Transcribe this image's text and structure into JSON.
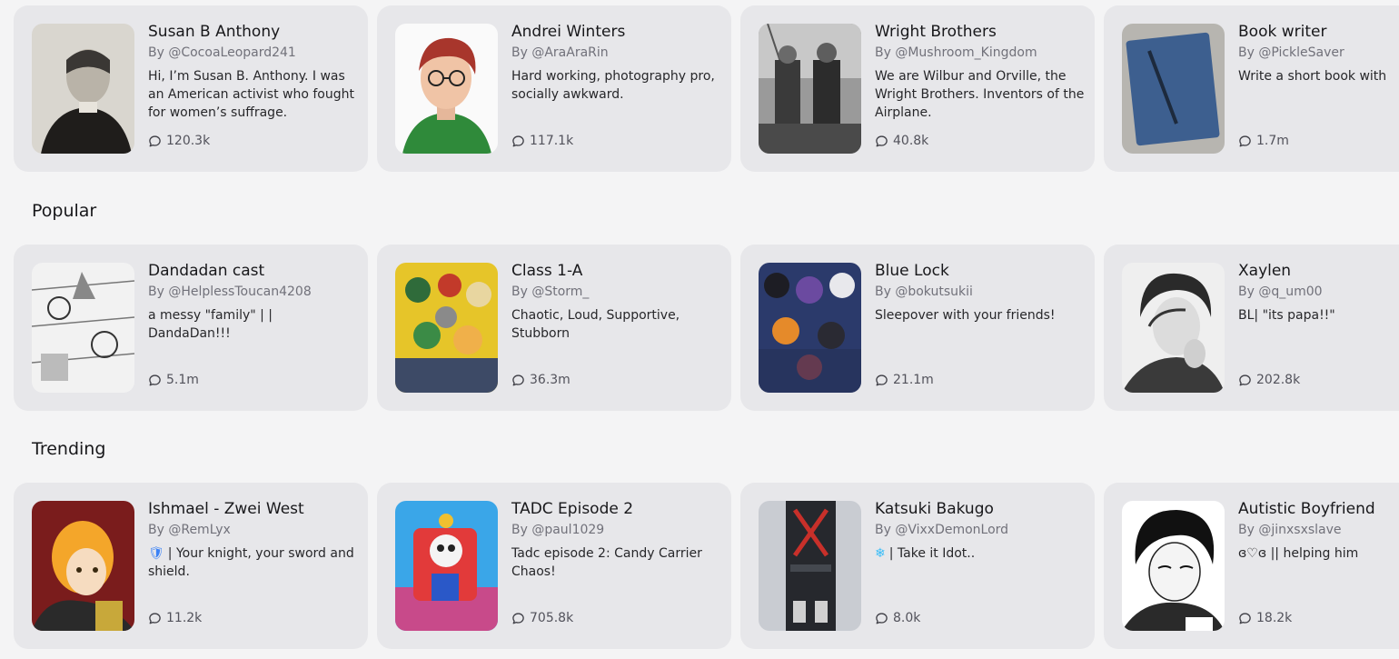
{
  "sections": [
    {
      "title": "",
      "cards": [
        {
          "name": "Susan B Anthony",
          "author": "By @CocoaLeopard241",
          "emoji": "",
          "description": "Hi, I’m Susan B. Anthony. I was an American activist who fought for women’s suffrage.",
          "chats": "120.3k"
        },
        {
          "name": "Andrei Winters",
          "author": "By @AraAraRin",
          "emoji": "",
          "description": "Hard working, photography pro, socially awkward.",
          "chats": "117.1k"
        },
        {
          "name": "Wright Brothers",
          "author": "By @Mushroom_Kingdom",
          "emoji": "",
          "description": "We are Wilbur and Orville, the Wright Brothers. Inventors of the Airplane.",
          "chats": "40.8k"
        },
        {
          "name": "Book writer",
          "author": "By @PickleSaver",
          "emoji": "",
          "description": "Write a short book with",
          "chats": "1.7m"
        }
      ]
    },
    {
      "title": "Popular",
      "cards": [
        {
          "name": "Dandadan cast",
          "author": "By @HelplessToucan4208",
          "emoji": "",
          "description": "a messy \"family\" | | DandaDan!!!",
          "chats": "5.1m"
        },
        {
          "name": "Class 1-A",
          "author": "By @Storm_",
          "emoji": "",
          "description": "Chaotic, Loud, Supportive, Stubborn",
          "chats": "36.3m"
        },
        {
          "name": "Blue Lock",
          "author": "By @bokutsukii",
          "emoji": "",
          "description": "Sleepover with your friends!",
          "chats": "21.1m"
        },
        {
          "name": "Xaylen",
          "author": "By @q_um00",
          "emoji": "",
          "description": "BL| \"its papa!!\"",
          "chats": "202.8k"
        }
      ]
    },
    {
      "title": "Trending",
      "cards": [
        {
          "name": "Ishmael - Zwei West",
          "author": "By @RemLyx",
          "emoji": "🛡",
          "description": "| Your knight, your sword and shield.",
          "chats": "11.2k"
        },
        {
          "name": "TADC Episode 2",
          "author": "By @paul1029",
          "emoji": "",
          "description": "Tadc episode 2: Candy Carrier Chaos!",
          "chats": "705.8k"
        },
        {
          "name": "Katsuki Bakugo",
          "author": "By @VixxDemonLord",
          "emoji": "❄",
          "description": "| Take it Idot..",
          "chats": "8.0k"
        },
        {
          "name": "Autistic Boyfriend",
          "author": "By @jinxsxslave",
          "emoji": "",
          "description": "ɞ♡ɞ || helping him",
          "chats": "18.2k"
        }
      ]
    }
  ]
}
